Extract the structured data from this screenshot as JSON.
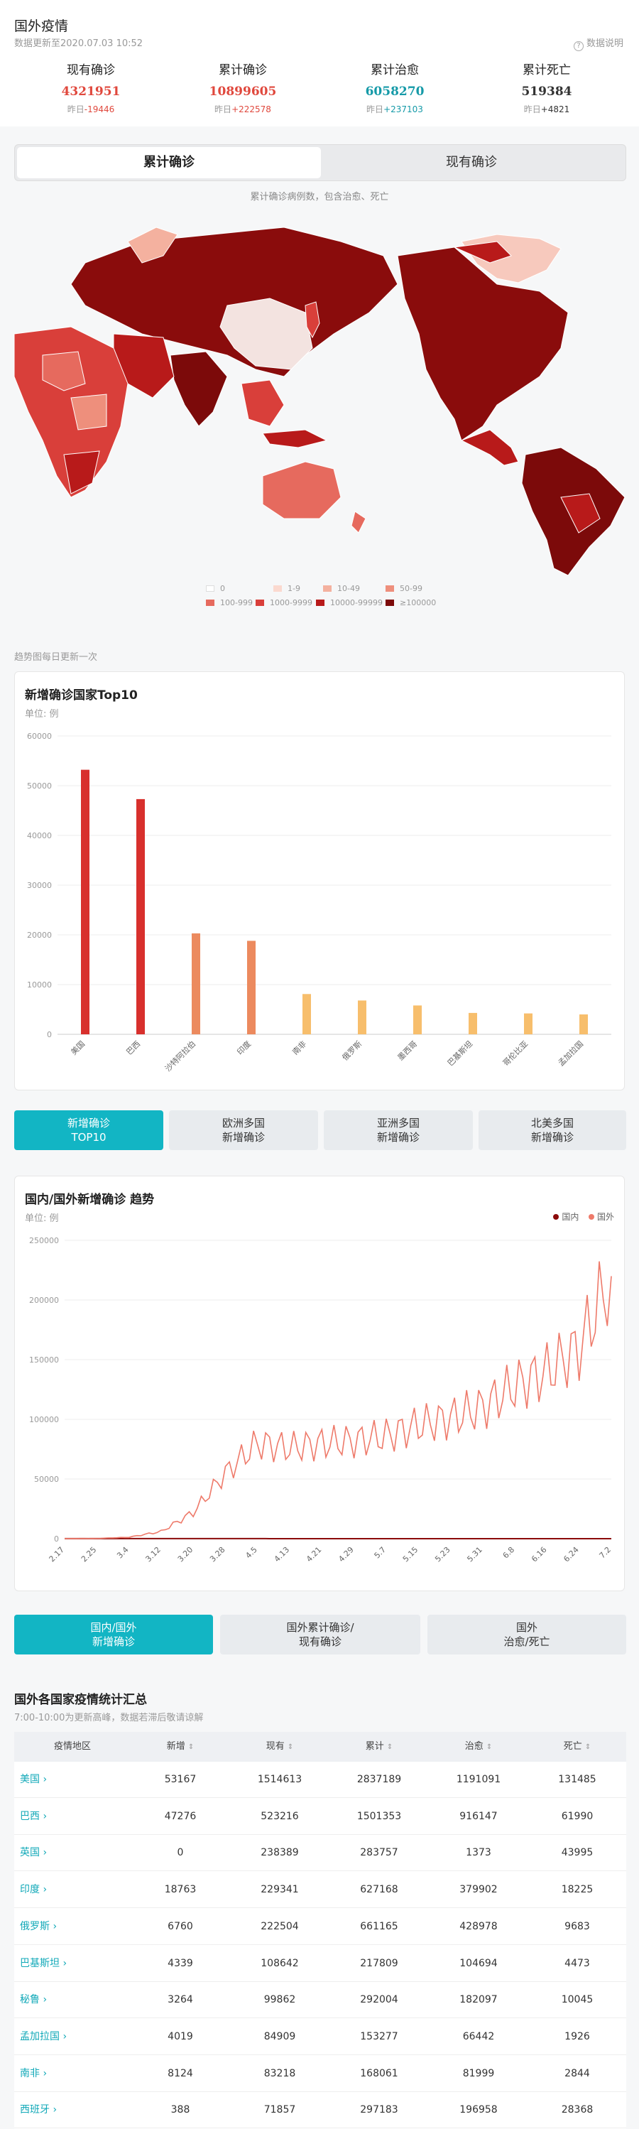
{
  "header": {
    "title": "国外疫情",
    "updated": "数据更新至2020.07.03 10:52",
    "data_note": "数据说明"
  },
  "stats": [
    {
      "label": "现有确诊",
      "value": "4321951",
      "change_prefix": "昨日",
      "change": "-19446",
      "color": "#e0483d"
    },
    {
      "label": "累计确诊",
      "value": "10899605",
      "change_prefix": "昨日",
      "change": "+222578",
      "color": "#e0483d"
    },
    {
      "label": "累计治愈",
      "value": "6058270",
      "change_prefix": "昨日",
      "change": "+237103",
      "color": "#159aa8"
    },
    {
      "label": "累计死亡",
      "value": "519384",
      "change_prefix": "昨日",
      "change": "+4821",
      "color": "#333333"
    }
  ],
  "map_tabs": {
    "active": "累计确诊",
    "inactive": "现有确诊"
  },
  "map_desc": "累计确诊病例数，包含治愈、死亡",
  "map_legend": [
    {
      "label": "0",
      "color": "#ffffff"
    },
    {
      "label": "1-9",
      "color": "#fbd9cf"
    },
    {
      "label": "10-49",
      "color": "#f4b19f"
    },
    {
      "label": "50-99",
      "color": "#ee8f7c"
    },
    {
      "label": "100-999",
      "color": "#e66a5e"
    },
    {
      "label": "1000-9999",
      "color": "#d93f3a"
    },
    {
      "label": "10000-99999",
      "color": "#b81a1a"
    },
    {
      "label": "≥100000",
      "color": "#7c0a0a"
    }
  ],
  "trend_note": "趋势图每日更新一次",
  "chart_top10": {
    "title": "新增确诊国家Top10",
    "unit": "单位: 例"
  },
  "tabs_top10": [
    {
      "line1": "新增确诊",
      "line2": "TOP10"
    },
    {
      "line1": "欧洲多国",
      "line2": "新增确诊"
    },
    {
      "line1": "亚洲多国",
      "line2": "新增确诊"
    },
    {
      "line1": "北美多国",
      "line2": "新增确诊"
    }
  ],
  "chart_trend": {
    "title": "国内/国外新增确诊 趋势",
    "unit": "单位: 例",
    "legend_domestic": "国内",
    "legend_foreign": "国外"
  },
  "tabs_trend": [
    {
      "line1": "国内/国外",
      "line2": "新增确诊"
    },
    {
      "line1": "国外累计确诊/",
      "line2": "现有确诊"
    },
    {
      "line1": "国外",
      "line2": "治愈/死亡"
    }
  ],
  "summary": {
    "title": "国外各国家疫情统计汇总",
    "note": "7:00-10:00为更新高峰，数据若滞后敬请谅解",
    "columns": [
      "疫情地区",
      "新增",
      "现有",
      "累计",
      "治愈",
      "死亡"
    ],
    "sort_arrow": "⇕",
    "rows": [
      [
        "美国",
        "53167",
        "1514613",
        "2837189",
        "1191091",
        "131485"
      ],
      [
        "巴西",
        "47276",
        "523216",
        "1501353",
        "916147",
        "61990"
      ],
      [
        "英国",
        "0",
        "238389",
        "283757",
        "1373",
        "43995"
      ],
      [
        "印度",
        "18763",
        "229341",
        "627168",
        "379902",
        "18225"
      ],
      [
        "俄罗斯",
        "6760",
        "222504",
        "661165",
        "428978",
        "9683"
      ],
      [
        "巴基斯坦",
        "4339",
        "108642",
        "217809",
        "104694",
        "4473"
      ],
      [
        "秘鲁",
        "3264",
        "99862",
        "292004",
        "182097",
        "10045"
      ],
      [
        "孟加拉国",
        "4019",
        "84909",
        "153277",
        "66442",
        "1926"
      ],
      [
        "南非",
        "8124",
        "83218",
        "168061",
        "81999",
        "2844"
      ],
      [
        "西班牙",
        "388",
        "71857",
        "297183",
        "196958",
        "28368"
      ]
    ]
  },
  "chart_data": [
    {
      "type": "bar",
      "title": "新增确诊国家Top10",
      "ylabel": "单位: 例",
      "ylim": [
        0,
        60000
      ],
      "yticks": [
        "0",
        "10000",
        "20000",
        "30000",
        "40000",
        "50000",
        "60000"
      ],
      "categories": [
        "美国",
        "巴西",
        "沙特阿拉伯",
        "印度",
        "南非",
        "俄罗斯",
        "墨西哥",
        "巴基斯坦",
        "哥伦比亚",
        "孟加拉国"
      ],
      "values": [
        53200,
        47300,
        20300,
        18800,
        8100,
        6800,
        5800,
        4300,
        4200,
        4000
      ],
      "colors": [
        "#d8302d",
        "#d8302d",
        "#ec8a5e",
        "#ec8a5e",
        "#f7be6c",
        "#f7be6c",
        "#f7be6c",
        "#f7be6c",
        "#f7be6c",
        "#f7be6c"
      ]
    },
    {
      "type": "line",
      "title": "国内/国外新增确诊 趋势",
      "ylabel": "单位: 例",
      "ylim": [
        0,
        250000
      ],
      "yticks": [
        "0",
        "50000",
        "100000",
        "150000",
        "200000",
        "250000"
      ],
      "x": [
        "2.17",
        "2.25",
        "3.4",
        "3.12",
        "3.20",
        "3.28",
        "4.5",
        "4.13",
        "4.21",
        "4.29",
        "5.7",
        "5.15",
        "5.23",
        "5.31",
        "6.8",
        "6.16",
        "6.24",
        "7.2"
      ],
      "series": [
        {
          "name": "国内",
          "color": "#8b0a0a",
          "values": [
            100,
            50,
            100,
            50,
            40,
            50,
            40,
            30,
            10,
            10,
            5,
            10,
            5,
            5,
            10,
            30,
            20,
            5
          ]
        },
        {
          "name": "国外",
          "color": "#ee7a6a",
          "values": [
            100,
            200,
            1200,
            6000,
            22000,
            55000,
            80000,
            76000,
            80000,
            82000,
            86000,
            95000,
            101000,
            110000,
            128000,
            140000,
            160000,
            220000
          ]
        }
      ]
    }
  ]
}
